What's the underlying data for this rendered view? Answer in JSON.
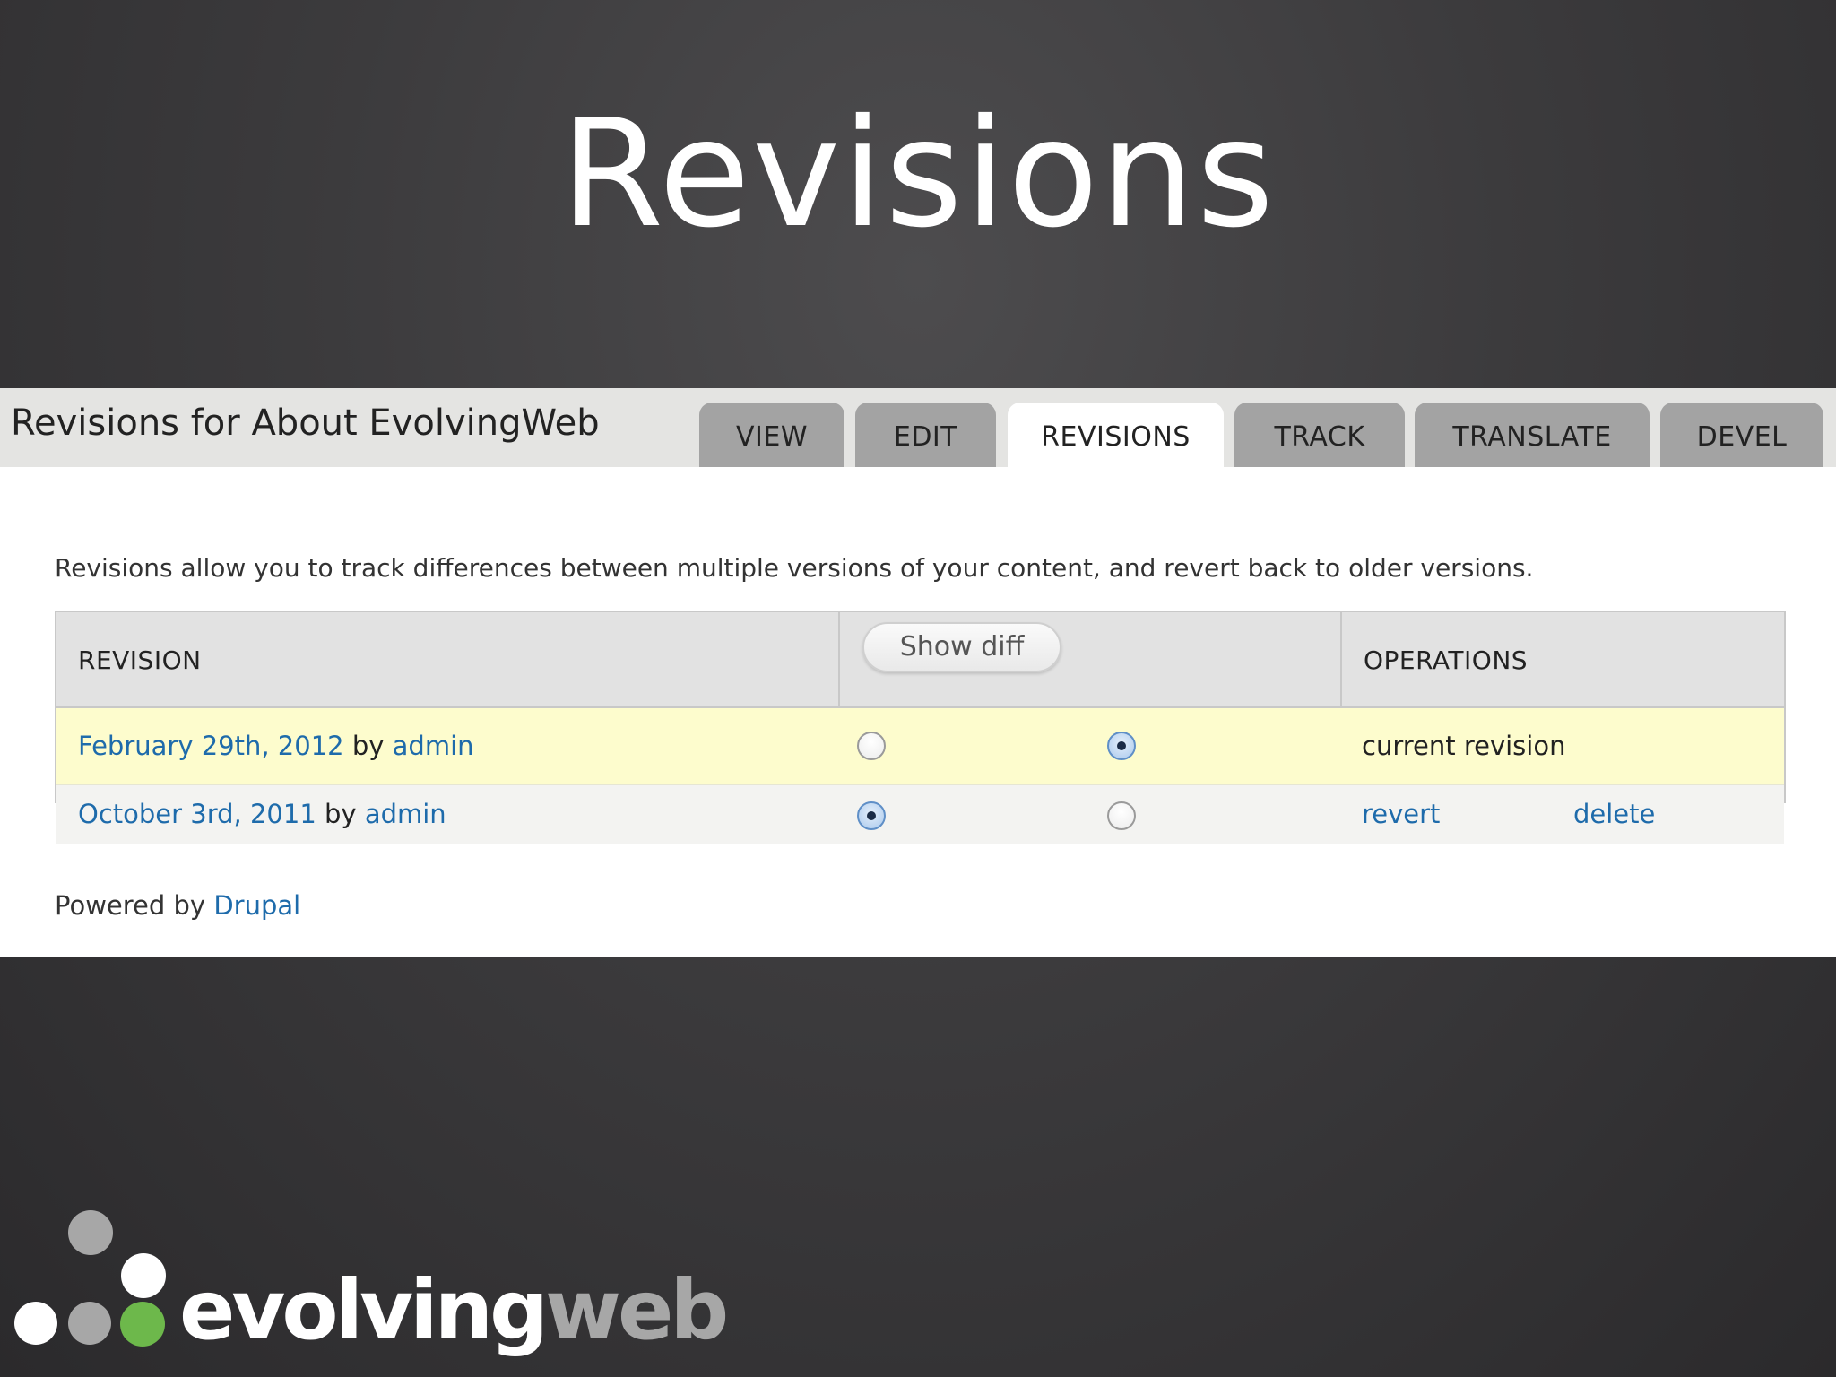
{
  "slide": {
    "title": "Revisions"
  },
  "page": {
    "heading": "Revisions for About EvolvingWeb",
    "tabs": [
      {
        "label": "VIEW",
        "active": false
      },
      {
        "label": "EDIT",
        "active": false
      },
      {
        "label": "REVISIONS",
        "active": true
      },
      {
        "label": "TRACK",
        "active": false
      },
      {
        "label": "TRANSLATE",
        "active": false
      },
      {
        "label": "DEVEL",
        "active": false
      }
    ],
    "intro": "Revisions allow you to track differences between multiple versions of your content, and revert back to older versions."
  },
  "table": {
    "headers": {
      "revision": "REVISION",
      "show_diff": "Show diff",
      "operations": "OPERATIONS"
    },
    "rows": [
      {
        "date": "February 29th, 2012",
        "by": "by",
        "author": "admin",
        "left_radio_checked": false,
        "right_radio_checked": true,
        "status": "current revision",
        "highlight_color": "#fdfccd"
      },
      {
        "date": "October 3rd, 2011",
        "by": "by",
        "author": "admin",
        "left_radio_checked": true,
        "right_radio_checked": false,
        "op_revert": "revert",
        "op_delete": "delete"
      }
    ]
  },
  "footer": {
    "powered_by": "Powered by",
    "drupal": "Drupal"
  },
  "logo": {
    "word1": "evolving",
    "word2": "web",
    "colors": {
      "white": "#ffffff",
      "gray": "#a7a7a7",
      "green": "#6db84b"
    }
  },
  "colors": {
    "link": "#1e6bab",
    "background": "#3c3b3d"
  }
}
